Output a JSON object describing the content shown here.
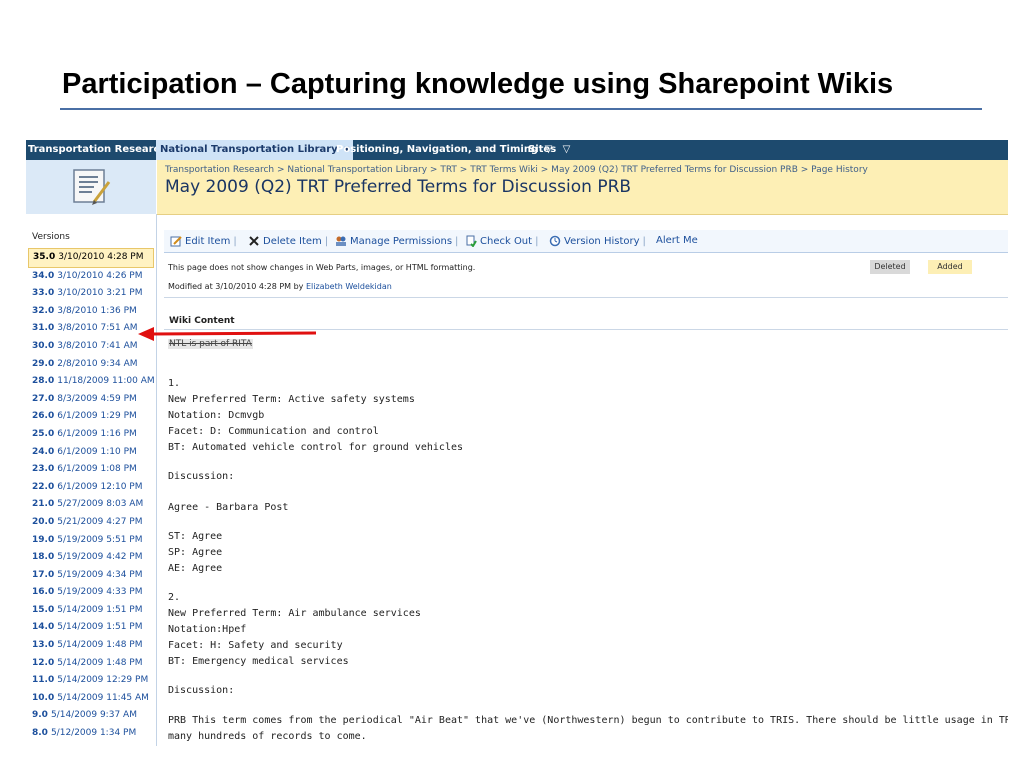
{
  "slide": {
    "title": "Participation – Capturing knowledge using Sharepoint Wikis"
  },
  "topnav": {
    "site": "Transportation Research",
    "tabs": [
      {
        "label": "National Transportation Library",
        "arrow": "▾"
      },
      {
        "label": "Positioning, Navigation, and Timing",
        "arrow": "▽"
      },
      {
        "label": "Sites",
        "arrow": "▽"
      }
    ]
  },
  "header": {
    "breadcrumb": "Transportation Research > National Transportation Library > TRT > TRT Terms Wiki > May 2009 (Q2) TRT Preferred Terms for Discussion PRB > Page History",
    "title": "May 2009 (Q2) TRT Preferred Terms for Discussion PRB"
  },
  "toolbar": {
    "edit_item": "Edit Item",
    "delete_item": "Delete Item",
    "manage_permissions": "Manage Permissions",
    "check_out": "Check Out",
    "version_history": "Version History",
    "alert_me": "Alert Me"
  },
  "info": {
    "notice": "This page does not show changes in Web Parts, images, or HTML formatting.",
    "legend_deleted": "Deleted",
    "legend_added": "Added",
    "modified_prefix": "Modified at 3/10/2010 4:28 PM  by",
    "modified_by": "Elizabeth Weldekidan"
  },
  "versions": {
    "label": "Versions",
    "items": [
      {
        "num": "35.0",
        "date": "3/10/2010 4:28 PM"
      },
      {
        "num": "34.0",
        "date": "3/10/2010 4:26 PM"
      },
      {
        "num": "33.0",
        "date": "3/10/2010 3:21 PM"
      },
      {
        "num": "32.0",
        "date": "3/8/2010 1:36 PM"
      },
      {
        "num": "31.0",
        "date": "3/8/2010 7:51 AM"
      },
      {
        "num": "30.0",
        "date": "3/8/2010 7:41 AM"
      },
      {
        "num": "29.0",
        "date": "2/8/2010 9:34 AM"
      },
      {
        "num": "28.0",
        "date": "11/18/2009 11:00 AM"
      },
      {
        "num": "27.0",
        "date": "8/3/2009 4:59 PM"
      },
      {
        "num": "26.0",
        "date": "6/1/2009 1:29 PM"
      },
      {
        "num": "25.0",
        "date": "6/1/2009 1:16 PM"
      },
      {
        "num": "24.0",
        "date": "6/1/2009 1:10 PM"
      },
      {
        "num": "23.0",
        "date": "6/1/2009 1:08 PM"
      },
      {
        "num": "22.0",
        "date": "6/1/2009 12:10 PM"
      },
      {
        "num": "21.0",
        "date": "5/27/2009 8:03 AM"
      },
      {
        "num": "20.0",
        "date": "5/21/2009 4:27 PM"
      },
      {
        "num": "19.0",
        "date": "5/19/2009 5:51 PM"
      },
      {
        "num": "18.0",
        "date": "5/19/2009 4:42 PM"
      },
      {
        "num": "17.0",
        "date": "5/19/2009 4:34 PM"
      },
      {
        "num": "16.0",
        "date": "5/19/2009 4:33 PM"
      },
      {
        "num": "15.0",
        "date": "5/14/2009 1:51 PM"
      },
      {
        "num": "14.0",
        "date": "5/14/2009 1:51 PM"
      },
      {
        "num": "13.0",
        "date": "5/14/2009 1:48 PM"
      },
      {
        "num": "12.0",
        "date": "5/14/2009 1:48 PM"
      },
      {
        "num": "11.0",
        "date": "5/14/2009 12:29 PM"
      },
      {
        "num": "10.0",
        "date": "5/14/2009 11:45 AM"
      },
      {
        "num": "9.0",
        "date": "5/14/2009 9:37 AM"
      },
      {
        "num": "8.0",
        "date": "5/12/2009 1:34 PM"
      }
    ]
  },
  "wiki": {
    "label": "Wiki Content",
    "deleted_text": "NTL is part of RITA",
    "lines": [
      "1.",
      "New Preferred Term: Active safety systems",
      "Notation: Dcmvgb",
      "Facet: D: Communication and control",
      "BT: Automated vehicle control for ground vehicles",
      "Discussion:",
      "Agree - Barbara Post",
      "ST: Agree",
      "SP: Agree",
      "AE: Agree",
      "2.",
      "New Preferred Term: Air ambulance services",
      "Notation:Hpef",
      "Facet: H: Safety and security",
      "BT: Emergency medical services",
      "Discussion:",
      "PRB This term comes from the periodical \"Air Beat\" that we've (Northwestern) begun to contribute to TRIS. There should be little usage in TRIS s",
      "many hundreds of records to come."
    ]
  },
  "colors": {
    "nav_bar": "#1d4a6e",
    "header_bg": "#fdefb5",
    "link": "#1c4f9c",
    "arrow": "#e01010"
  }
}
